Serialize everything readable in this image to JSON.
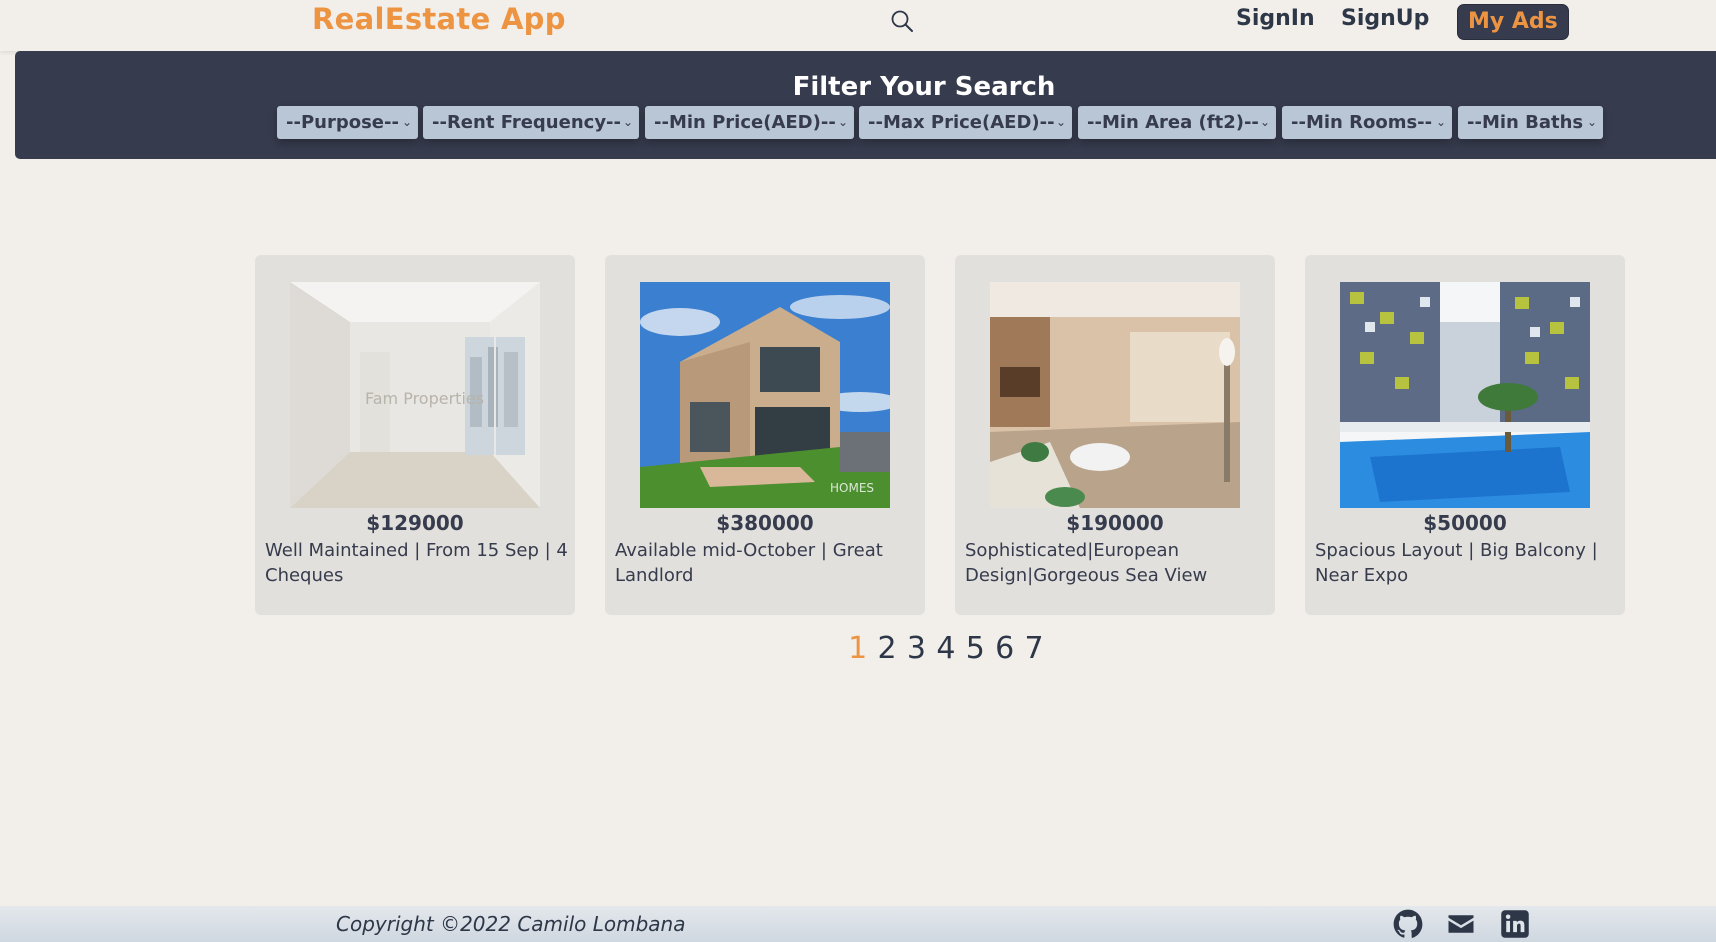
{
  "navbar": {
    "brand": "RealEstate App",
    "search_icon": "search-icon",
    "signin_label": "SignIn",
    "signup_label": "SignUp",
    "myads_label": "My Ads"
  },
  "filters": {
    "title": "Filter Your Search",
    "selects": [
      {
        "label": "--Purpose--"
      },
      {
        "label": "--Rent Frequency--"
      },
      {
        "label": "--Min Price(AED)--"
      },
      {
        "label": "--Max Price(AED)--"
      },
      {
        "label": "--Min Area (ft2)--"
      },
      {
        "label": "--Min Rooms--"
      },
      {
        "label": "--Min Baths"
      }
    ]
  },
  "listings": [
    {
      "price": "$129000",
      "title": "Well Maintained | From 15 Sep | 4 Cheques",
      "watermark": "Fam Properties"
    },
    {
      "price": "$380000",
      "title": "Available mid-October | Great Landlord",
      "watermark": "HOMES"
    },
    {
      "price": "$190000",
      "title": "Sophisticated|European Design|Gorgeous Sea View"
    },
    {
      "price": "$50000",
      "title": "Spacious Layout | Big Balcony | Near Expo"
    }
  ],
  "pagination": {
    "pages": [
      "1",
      "2",
      "3",
      "4",
      "5",
      "6",
      "7"
    ],
    "active": "1"
  },
  "footer": {
    "copyright": "Copyright ©2022 Camilo Lombana",
    "icons": [
      "github-icon",
      "mail-icon",
      "linkedin-icon"
    ]
  },
  "colors": {
    "accent": "#ed9443",
    "dark": "#363b4d",
    "background": "#f2efea",
    "card": "#e2e0dc",
    "select": "#b9c6d6"
  }
}
